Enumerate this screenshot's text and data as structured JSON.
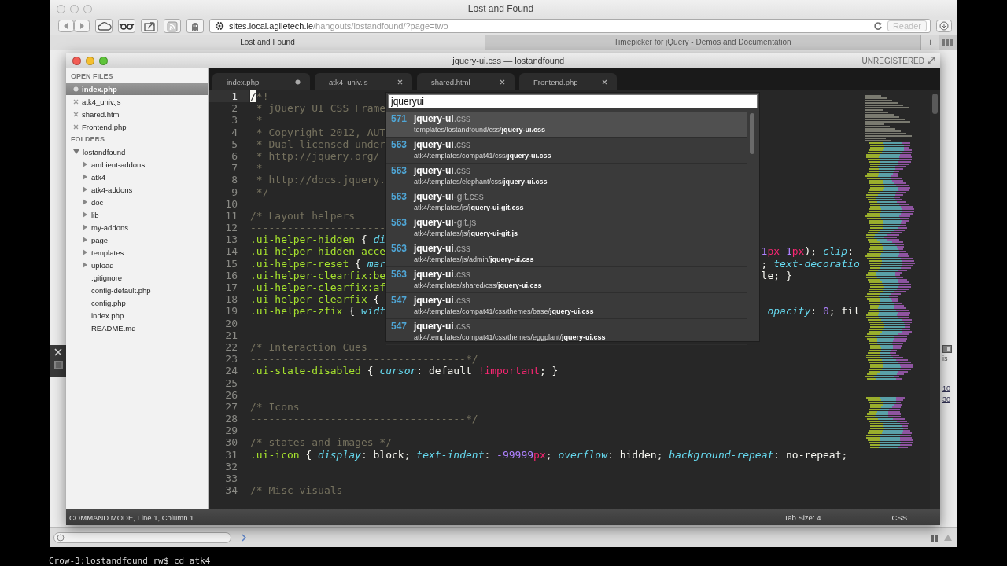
{
  "browser": {
    "title": "Lost and Found",
    "address": {
      "host": "sites.local.agiletech.ie",
      "path": "/hangouts/lostandfound/?page=two"
    },
    "reader_button": {
      "label": "Reader",
      "disabled": true
    },
    "tabs": [
      {
        "label": "Lost and Found",
        "selected": true
      },
      {
        "label": "Timepicker for jQuery - Demos and Documentation",
        "selected": false
      }
    ],
    "new_tab": "+",
    "page_fragments": [
      "is",
      "10",
      "30"
    ]
  },
  "editor": {
    "title": "jquery-ui.css — lostandfound",
    "license": "UNREGISTERED",
    "sidebar": {
      "open_files_heading": "OPEN FILES",
      "open_files": [
        {
          "label": "index.php",
          "selected": true,
          "modified": true
        },
        {
          "label": "atk4_univ.js",
          "selected": false,
          "modified": false
        },
        {
          "label": "shared.html",
          "selected": false,
          "modified": false
        },
        {
          "label": "Frontend.php",
          "selected": false,
          "modified": false
        }
      ],
      "folders_heading": "FOLDERS",
      "folders": [
        {
          "label": "lostandfound",
          "kind": "folder",
          "expanded": true,
          "children": [
            {
              "label": "ambient-addons",
              "kind": "folder",
              "expanded": false
            },
            {
              "label": "atk4",
              "kind": "folder",
              "expanded": false
            },
            {
              "label": "atk4-addons",
              "kind": "folder",
              "expanded": false
            },
            {
              "label": "doc",
              "kind": "folder",
              "expanded": false
            },
            {
              "label": "lib",
              "kind": "folder",
              "expanded": false
            },
            {
              "label": "my-addons",
              "kind": "folder",
              "expanded": false
            },
            {
              "label": "page",
              "kind": "folder",
              "expanded": false
            },
            {
              "label": "templates",
              "kind": "folder",
              "expanded": false
            },
            {
              "label": "upload",
              "kind": "folder",
              "expanded": false
            },
            {
              "label": ".gitignore",
              "kind": "file"
            },
            {
              "label": "config-default.php",
              "kind": "file"
            },
            {
              "label": "config.php",
              "kind": "file"
            },
            {
              "label": "index.php",
              "kind": "file"
            },
            {
              "label": "README.md",
              "kind": "file"
            }
          ]
        }
      ]
    },
    "tabs": [
      {
        "label": "index.php",
        "modified": true,
        "selected": false
      },
      {
        "label": "atk4_univ.js",
        "modified": false,
        "selected": false
      },
      {
        "label": "shared.html",
        "modified": false,
        "selected": false
      },
      {
        "label": "Frontend.php",
        "modified": false,
        "selected": false
      }
    ],
    "lines": [
      {
        "n": "1",
        "current": true,
        "tokens": [
          {
            "text": "/",
            "kind": "cursor"
          },
          {
            "text": "*!",
            "kind": "comment"
          }
        ]
      },
      {
        "n": "2",
        "current": false,
        "tokens": [
          {
            "text": " * jQuery UI CSS Frame",
            "kind": "comment"
          }
        ]
      },
      {
        "n": "3",
        "current": false,
        "tokens": [
          {
            "text": " *",
            "kind": "comment"
          }
        ]
      },
      {
        "n": "4",
        "current": false,
        "tokens": [
          {
            "text": " * Copyright 2012, AUT",
            "kind": "comment"
          }
        ]
      },
      {
        "n": "5",
        "current": false,
        "tokens": [
          {
            "text": " * Dual licensed under",
            "kind": "comment"
          }
        ]
      },
      {
        "n": "6",
        "current": false,
        "tokens": [
          {
            "text": " * http://jquery.org/",
            "kind": "comment"
          }
        ]
      },
      {
        "n": "7",
        "current": false,
        "tokens": [
          {
            "text": " *",
            "kind": "comment"
          }
        ]
      },
      {
        "n": "8",
        "current": false,
        "tokens": [
          {
            "text": " * http://docs.jquery.",
            "kind": "comment"
          }
        ]
      },
      {
        "n": "9",
        "current": false,
        "tokens": [
          {
            "text": " */",
            "kind": "comment"
          }
        ]
      },
      {
        "n": "10",
        "current": false
      },
      {
        "n": "11",
        "current": false,
        "tokens": [
          {
            "text": "/* Layout helpers",
            "kind": "comment"
          }
        ]
      },
      {
        "n": "12",
        "current": false,
        "tokens": [
          {
            "text": "----------------------",
            "kind": "comment"
          }
        ]
      },
      {
        "n": "13",
        "current": false,
        "tokens": [
          {
            "text": ".ui-helper-hidden",
            "kind": "selector"
          },
          {
            "text": " { ",
            "kind": "plain"
          },
          {
            "text": "di",
            "kind": "property"
          }
        ]
      },
      {
        "n": "14",
        "current": false,
        "tokens": [
          {
            "text": ".ui-helper-hidden-acce",
            "kind": "selector"
          }
        ],
        "right": [
          {
            "text": "1",
            "kind": "number"
          },
          {
            "text": "px ",
            "kind": "unit"
          },
          {
            "text": "1",
            "kind": "number"
          },
          {
            "text": "px",
            "kind": "unit"
          },
          {
            "text": "); ",
            "kind": "plain"
          },
          {
            "text": "clip",
            "kind": "property"
          },
          {
            "text": ":",
            "kind": "plain"
          }
        ]
      },
      {
        "n": "15",
        "current": false,
        "tokens": [
          {
            "text": ".ui-helper-reset",
            "kind": "selector"
          },
          {
            "text": " { ",
            "kind": "plain"
          },
          {
            "text": "mar",
            "kind": "property"
          }
        ],
        "right": [
          {
            "text": "; ",
            "kind": "plain"
          },
          {
            "text": "text-decoratio",
            "kind": "property"
          }
        ]
      },
      {
        "n": "16",
        "current": false,
        "tokens": [
          {
            "text": ".ui-helper-clearfix:be",
            "kind": "selector"
          }
        ],
        "right": [
          {
            "text": "le; }",
            "kind": "plain"
          }
        ]
      },
      {
        "n": "17",
        "current": false,
        "tokens": [
          {
            "text": ".ui-helper-clearfix:af",
            "kind": "selector"
          }
        ]
      },
      {
        "n": "18",
        "current": false,
        "tokens": [
          {
            "text": ".ui-helper-clearfix",
            "kind": "selector"
          },
          {
            "text": " {",
            "kind": "plain"
          }
        ]
      },
      {
        "n": "19",
        "current": false,
        "tokens": [
          {
            "text": ".ui-helper-zfix",
            "kind": "selector"
          },
          {
            "text": " { ",
            "kind": "plain"
          },
          {
            "text": "widt",
            "kind": "property"
          }
        ],
        "right": [
          {
            "text": " opacity",
            "kind": "property"
          },
          {
            "text": ": ",
            "kind": "plain"
          },
          {
            "text": "0",
            "kind": "number"
          },
          {
            "text": "; fil",
            "kind": "plain"
          }
        ]
      },
      {
        "n": "20",
        "current": false
      },
      {
        "n": "21",
        "current": false
      },
      {
        "n": "22",
        "current": false,
        "tokens": [
          {
            "text": "/* Interaction Cues",
            "kind": "comment"
          }
        ]
      },
      {
        "n": "23",
        "current": false,
        "tokens": [
          {
            "text": "-----------------------------------*/",
            "kind": "comment"
          }
        ]
      },
      {
        "n": "24",
        "current": false,
        "tokens": [
          {
            "text": ".ui-state-disabled",
            "kind": "selector"
          },
          {
            "text": " { ",
            "kind": "plain"
          },
          {
            "text": "cursor",
            "kind": "property"
          },
          {
            "text": ": default ",
            "kind": "plain"
          },
          {
            "text": "!important",
            "kind": "keyword"
          },
          {
            "text": "; }",
            "kind": "plain"
          }
        ]
      },
      {
        "n": "25",
        "current": false
      },
      {
        "n": "26",
        "current": false
      },
      {
        "n": "27",
        "current": false,
        "tokens": [
          {
            "text": "/* Icons",
            "kind": "comment"
          }
        ]
      },
      {
        "n": "28",
        "current": false,
        "tokens": [
          {
            "text": "-----------------------------------*/",
            "kind": "comment"
          }
        ]
      },
      {
        "n": "29",
        "current": false
      },
      {
        "n": "30",
        "current": false,
        "tokens": [
          {
            "text": "/* states and images */",
            "kind": "comment"
          }
        ]
      },
      {
        "n": "31",
        "current": false,
        "tokens": [
          {
            "text": ".ui-icon",
            "kind": "selector"
          },
          {
            "text": " { ",
            "kind": "plain"
          },
          {
            "text": "display",
            "kind": "property"
          },
          {
            "text": ": block; ",
            "kind": "plain"
          },
          {
            "text": "text-indent",
            "kind": "property"
          },
          {
            "text": ": ",
            "kind": "plain"
          },
          {
            "text": "-99999",
            "kind": "number"
          },
          {
            "text": "px",
            "kind": "unit"
          },
          {
            "text": "; ",
            "kind": "plain"
          },
          {
            "text": "overflow",
            "kind": "property"
          },
          {
            "text": ": hidden; ",
            "kind": "plain"
          },
          {
            "text": "background-repeat",
            "kind": "property"
          },
          {
            "text": ": no-repeat;",
            "kind": "plain"
          }
        ]
      },
      {
        "n": "32",
        "current": false
      },
      {
        "n": "33",
        "current": false
      },
      {
        "n": "34",
        "current": false,
        "tokens": [
          {
            "text": "/* Misc visuals",
            "kind": "comment"
          }
        ]
      }
    ],
    "goto": {
      "value": "jqueryui",
      "results": [
        {
          "score": "571",
          "name": "**jquery-ui**.css",
          "path": "templates/lostandfound/css/**jquery-ui.css**",
          "selected": true
        },
        {
          "score": "563",
          "name": "**jquery-ui**.css",
          "path": "atk4/templates/compat41/css/**jquery-ui.css**",
          "selected": false
        },
        {
          "score": "563",
          "name": "**jquery-ui**.css",
          "path": "atk4/templates/elephant/css/**jquery-ui.css**",
          "selected": false
        },
        {
          "score": "563",
          "name": "**jquery-ui**-git.css",
          "path": "atk4/templates/js/**jquery-ui-git.css**",
          "selected": false
        },
        {
          "score": "563",
          "name": "**jquery-ui**-git.js",
          "path": "atk4/templates/js/**jquery-ui-git.js**",
          "selected": false
        },
        {
          "score": "563",
          "name": "**jquery-ui**.css",
          "path": "atk4/templates/js/admin/**jquery-ui.css**",
          "selected": false
        },
        {
          "score": "563",
          "name": "**jquery-ui**.css",
          "path": "atk4/templates/shared/css/**jquery-ui.css**",
          "selected": false
        },
        {
          "score": "547",
          "name": "**jquery-ui**.css",
          "path": "atk4/templates/compat41/css/themes/base/**jquery-ui.css**",
          "selected": false
        },
        {
          "score": "547",
          "name": "**jquery-ui**.css",
          "path": "atk4/templates/compat41/css/themes/eggplant/**jquery-ui.css**",
          "selected": false
        }
      ]
    },
    "status": {
      "mode": "COMMAND MODE, Line 1, Column 1",
      "tab_size": "Tab Size: 4",
      "syntax": "CSS"
    }
  },
  "terminal": {
    "line": "Crow-3:lostandfound rw$ cd atk4"
  }
}
